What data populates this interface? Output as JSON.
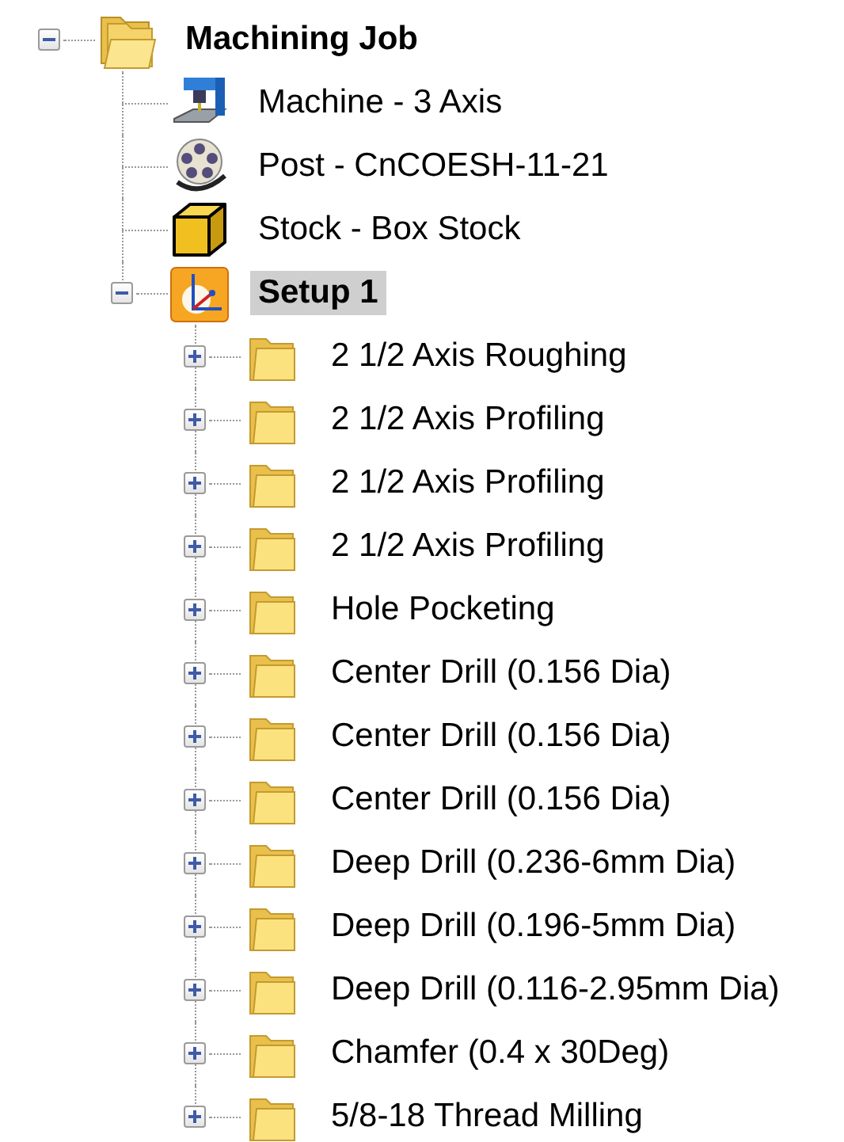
{
  "tree": {
    "label": "Machining Job",
    "kind": "job",
    "expanded": true,
    "selected": false,
    "children": [
      {
        "label": "Machine - 3 Axis",
        "kind": "machine",
        "selected": false
      },
      {
        "label": "Post - CnCOESH-11-21",
        "kind": "post",
        "selected": false
      },
      {
        "label": "Stock - Box Stock",
        "kind": "stock",
        "selected": false
      },
      {
        "label": "Setup 1",
        "kind": "setup",
        "expanded": true,
        "selected": true,
        "children": [
          {
            "label": "2 1/2 Axis Roughing",
            "kind": "folder",
            "expanded": false,
            "selected": false
          },
          {
            "label": "2 1/2 Axis Profiling",
            "kind": "folder",
            "expanded": false,
            "selected": false
          },
          {
            "label": "2 1/2 Axis Profiling",
            "kind": "folder",
            "expanded": false,
            "selected": false
          },
          {
            "label": "2 1/2 Axis Profiling",
            "kind": "folder",
            "expanded": false,
            "selected": false
          },
          {
            "label": "Hole Pocketing",
            "kind": "folder",
            "expanded": false,
            "selected": false
          },
          {
            "label": "Center Drill (0.156 Dia)",
            "kind": "folder",
            "expanded": false,
            "selected": false
          },
          {
            "label": "Center Drill (0.156 Dia)",
            "kind": "folder",
            "expanded": false,
            "selected": false
          },
          {
            "label": "Center Drill (0.156 Dia)",
            "kind": "folder",
            "expanded": false,
            "selected": false
          },
          {
            "label": "Deep Drill (0.236-6mm Dia)",
            "kind": "folder",
            "expanded": false,
            "selected": false
          },
          {
            "label": "Deep Drill (0.196-5mm Dia)",
            "kind": "folder",
            "expanded": false,
            "selected": false
          },
          {
            "label": "Deep Drill (0.116-2.95mm Dia)",
            "kind": "folder",
            "expanded": false,
            "selected": false
          },
          {
            "label": "Chamfer (0.4 x 30Deg)",
            "kind": "folder",
            "expanded": false,
            "selected": false
          },
          {
            "label": "5/8-18 Thread Milling",
            "kind": "folder",
            "expanded": false,
            "selected": false
          }
        ]
      }
    ]
  }
}
